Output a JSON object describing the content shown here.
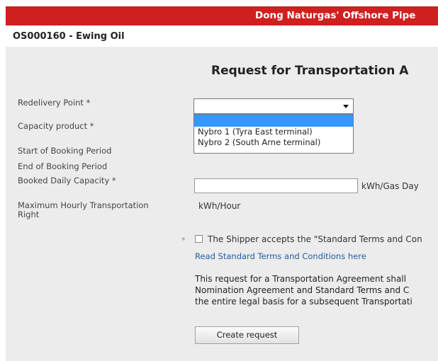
{
  "header": {
    "title": "Dong Naturgas' Offshore Pipe"
  },
  "shipper": {
    "label": "OS000160  -  Ewing Oil"
  },
  "page": {
    "heading": "Request for Transportation A"
  },
  "form": {
    "redelivery_point_label": "Redelivery Point *",
    "capacity_product_label": "Capacity product *",
    "start_booking_label": "Start of Booking Period",
    "end_booking_label": "End of Booking Period",
    "booked_daily_label": "Booked Daily Capacity *",
    "max_hourly_label_line1": "Maximum Hourly Transportation",
    "max_hourly_label_line2": "Right",
    "redelivery_selected": "",
    "redelivery_options": [
      "",
      "Nybro 1 (Tyra East terminal)",
      "Nybro 2 (South Arne terminal)"
    ],
    "booked_daily_value": "",
    "booked_daily_unit": "kWh/Gas Day",
    "max_hourly_unit": "kWh/Hour"
  },
  "terms": {
    "required_mark": "*",
    "accept_text": "The Shipper accepts the \"Standard Terms and Con",
    "link_text": "Read Standard Terms and Conditions here",
    "checked": false
  },
  "note": {
    "line1": "This request for a Transportation Agreement shall",
    "line2": "Nomination Agreement and Standard Terms and C",
    "line3": "the entire legal basis for a subsequent Transportati"
  },
  "actions": {
    "create_label": "Create request"
  },
  "colors": {
    "header_bg": "#d01f1f",
    "panel_bg": "#ececec",
    "link": "#1f5fa8",
    "selected_option": "#3399ff"
  },
  "icons": {
    "dropdown": "chevron-down-icon",
    "checkbox": "checkbox-icon"
  }
}
